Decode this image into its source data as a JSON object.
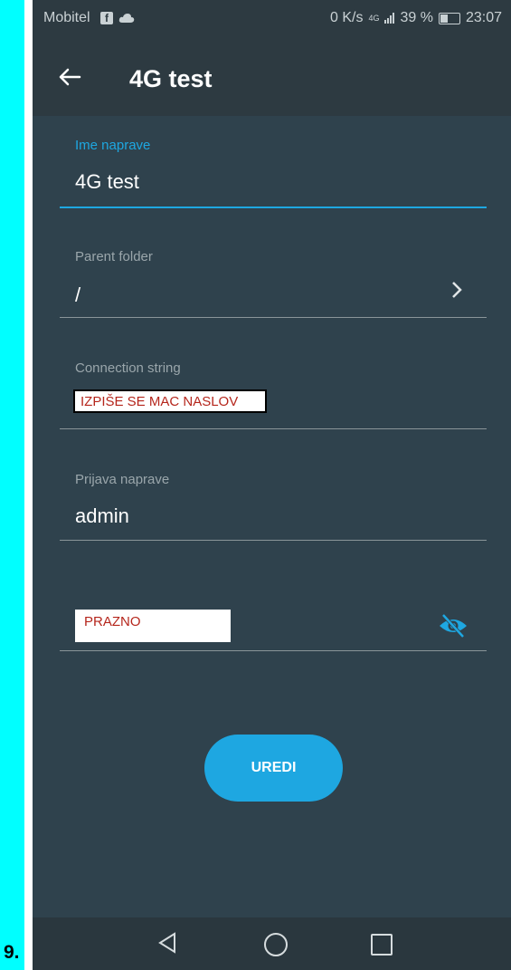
{
  "slide": {
    "number": "9."
  },
  "statusbar": {
    "carrier": "Mobitel",
    "right_text": "0 K/s",
    "network": "4G",
    "battery": "39 %",
    "time": "23:07"
  },
  "toolbar": {
    "title": "4G test"
  },
  "form": {
    "device_name": {
      "label": "Ime naprave",
      "value": "4G test"
    },
    "parent_folder": {
      "label": "Parent folder",
      "value": "/"
    },
    "connection_string": {
      "label": "Connection string",
      "note": "IZPIŠE SE MAC NASLOV"
    },
    "device_login": {
      "label": "Prijava naprave",
      "value": "admin"
    },
    "password": {
      "note": "PRAZNO"
    }
  },
  "actions": {
    "edit_label": "UREDI"
  },
  "colors": {
    "accent": "#1ea7e1",
    "background": "#2f424d",
    "toolbar": "#2d3a41",
    "side_bar": "#00ffff",
    "annotation_text": "#b5261c"
  },
  "icons": [
    "arrow-left-icon",
    "chevron-right-icon",
    "eye-off-icon",
    "nav-back-icon",
    "nav-home-icon",
    "nav-recent-icon",
    "facebook-icon",
    "cloud-icon",
    "signal-icon",
    "battery-icon"
  ]
}
